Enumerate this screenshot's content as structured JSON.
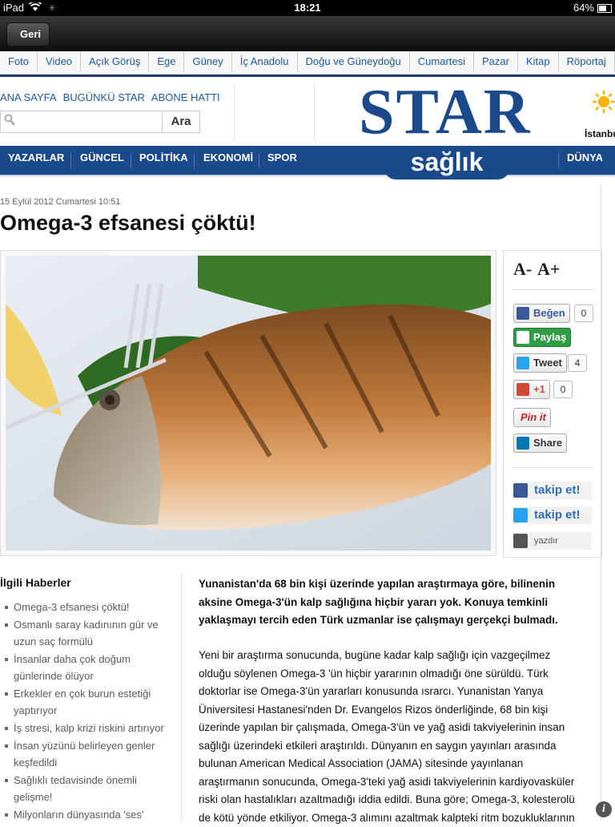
{
  "status_bar": {
    "device": "iPad",
    "time": "18:21",
    "battery": "64%",
    "battery_level": 0.64
  },
  "nav": {
    "back_label": "Geri"
  },
  "categories": [
    "Foto",
    "Video",
    "Açık Görüş",
    "Ege",
    "Güney",
    "İç Anadolu",
    "Doğu ve Güneydoğu",
    "Cumartesi",
    "Pazar",
    "Kitap",
    "Röportaj",
    "T"
  ],
  "header": {
    "top_links": [
      "ANA SAYFA",
      "BUGÜNKÜ STAR",
      "ABONE HATTI"
    ],
    "search_placeholder": "",
    "search_button": "Ara",
    "logo": "STAR",
    "section_logo": "sağlık",
    "weather_city": "İstanbu"
  },
  "sections": {
    "left": [
      "YAZARLAR",
      "GÜNCEL",
      "POLİTİKA",
      "EKONOMİ",
      "SPOR"
    ],
    "right": "DÜNYA"
  },
  "article": {
    "date": "15 Eylül 2012 Cumartesi  10:51",
    "title": "Omega-3 efsanesi çöktü!",
    "lead": "Yunanistan'da 68 bin kişi üzerinde yapılan araştırmaya göre, bilinenin aksine Omega-3'ün kalp sağlığına hiçbir yararı yok. Konuya temkinli yaklaşmayı tercih eden Türk uzmanlar ise çalışmayı gerçekçi bulmadı.",
    "body": "Yeni bir araştırma sonucunda, bugüne kadar kalp sağlığı için vazgeçilmez olduğu söylenen Omega-3 'ün hiçbir yararının olmadığı öne sürüldü. Türk doktorlar ise Omega-3'ün yararları konusunda ısrarcı. Yunanistan Yanya Üniversitesi Hastanesi'nden Dr. Evangelos Rizos önderliğinde, 68 bin kişi üzerinde yapılan bir çalışmada, Omega-3'ün ve yağ asidi takviyelerinin insan sağlığı üzerindeki etkileri araştırıldı. Dünyanın en saygın yayınları arasında bulunan American Medical Association (JAMA) sitesinde yayınlanan araştırmanın sonucunda, Omega-3'teki yağ asidi takviyelerinin kardiyovasküler riski olan hastalıkları azaltmadığı iddia edildi. Buna göre; Omega-3, kolesterolü de kötü yönde etkiliyor. Omega-3 alımını azaltmak kalpteki ritm bozukluklarının"
  },
  "share": {
    "font_down": "A-",
    "font_up": "A+",
    "like_label": "Beğen",
    "like_count": "0",
    "share_label": "Paylaş",
    "tweet_label": "Tweet",
    "tweet_count": "4",
    "gplus_label": "+1",
    "gplus_count": "0",
    "pin_label": "Pin it",
    "linkedin_label": "Share",
    "follow_facebook": "takip et!",
    "follow_twitter": "takip et!",
    "print_label": "yazdır"
  },
  "related": {
    "heading": "İlgili Haberler",
    "items": [
      "Omega-3 efsanesi çöktü!",
      "Osmanlı saray kadınının gür ve uzun saç formülü",
      "İnsanlar daha çok doğum günlerinde ölüyor",
      "Erkekler en çok burun estetiği yaptırıyor",
      "İş stresi, kalp krizi riskini artırıyor",
      "İnsan yüzünü belirleyen genler keşfedildi",
      "Sağlıklı tedavisinde önemli gelişme!",
      "Milyonların dünyasında 'ses'"
    ]
  },
  "colors": {
    "brand_blue": "#1a4a8c",
    "link_blue": "#1c5a9b"
  }
}
